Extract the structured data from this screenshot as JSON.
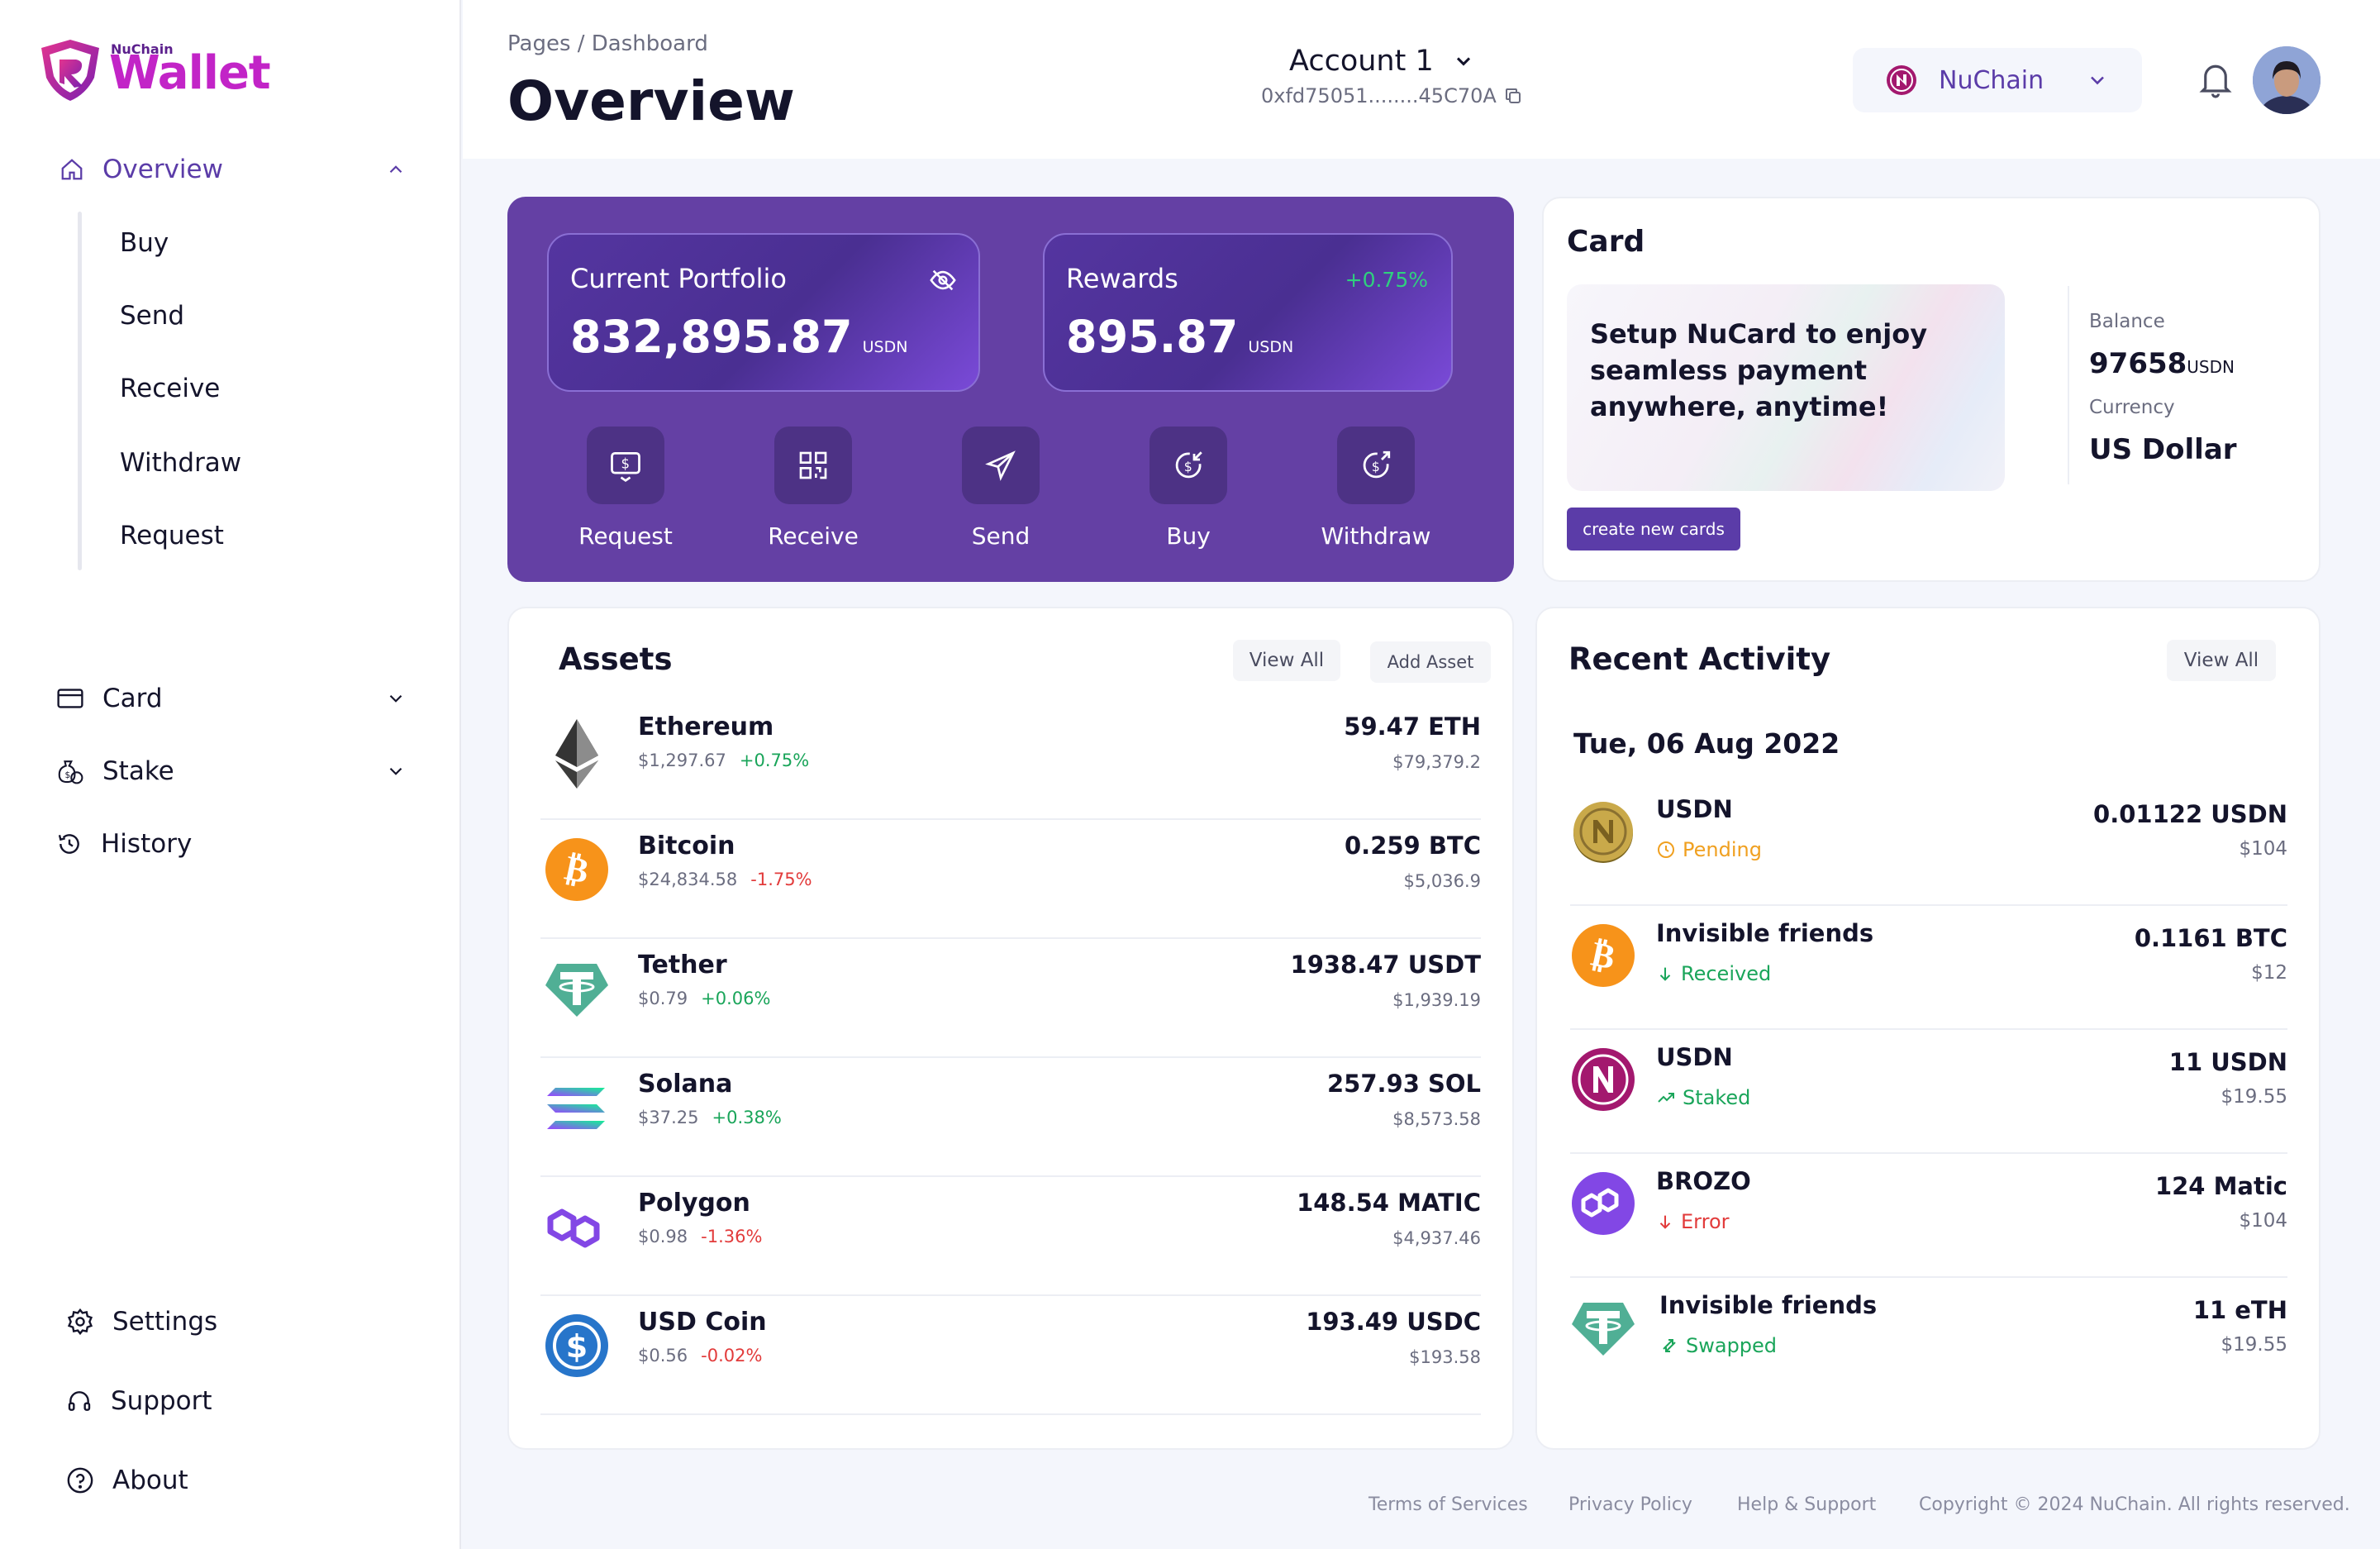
{
  "brand": {
    "small": "NuChain",
    "big": "Wallet"
  },
  "sidebar": {
    "overview": "Overview",
    "sub_items": [
      "Buy",
      "Send",
      "Receive",
      "Withdraw",
      "Request"
    ],
    "card": "Card",
    "stake": "Stake",
    "history": "History",
    "settings": "Settings",
    "support": "Support",
    "about": "About"
  },
  "header": {
    "breadcrumb": "Pages / Dashboard",
    "title": "Overview",
    "account": "Account 1",
    "address": "0xfd75051........45C70A",
    "chain": "NuChain"
  },
  "hero": {
    "portfolio": {
      "title": "Current Portfolio",
      "value": "832,895.87",
      "unit": "USDN"
    },
    "rewards": {
      "title": "Rewards",
      "value": "895.87",
      "unit": "USDN",
      "change": "+0.75%"
    },
    "actions": [
      "Request",
      "Receive",
      "Send",
      "Buy",
      "Withdraw"
    ]
  },
  "card_panel": {
    "title": "Card",
    "promo": "Setup NuCard to enjoy seamless payment anywhere, anytime!",
    "button": "create new cards",
    "balance_label": "Balance",
    "balance": "97658",
    "balance_unit": "USDN",
    "currency_label": "Currency",
    "currency": "US Dollar"
  },
  "assets": {
    "title": "Assets",
    "view_all": "View All",
    "add_asset": "Add Asset",
    "rows": [
      {
        "name": "Ethereum",
        "price": "$1,297.67",
        "change": "+0.75%",
        "amount": "59.47 ETH",
        "usd": "$79,379.2"
      },
      {
        "name": "Bitcoin",
        "price": "$24,834.58",
        "change": "-1.75%",
        "amount": "0.259 BTC",
        "usd": "$5,036.9"
      },
      {
        "name": "Tether",
        "price": "$0.79",
        "change": "+0.06%",
        "amount": "1938.47 USDT",
        "usd": "$1,939.19"
      },
      {
        "name": "Solana",
        "price": "$37.25",
        "change": "+0.38%",
        "amount": "257.93 SOL",
        "usd": "$8,573.58"
      },
      {
        "name": "Polygon",
        "price": "$0.98",
        "change": "-1.36%",
        "amount": "148.54 MATIC",
        "usd": "$4,937.46"
      },
      {
        "name": "USD Coin",
        "price": "$0.56",
        "change": "-0.02%",
        "amount": "193.49 USDC",
        "usd": "$193.58"
      }
    ]
  },
  "recent": {
    "title": "Recent Activity",
    "view_all": "View All",
    "date": "Tue, 06 Aug 2022",
    "rows": [
      {
        "name": "USDN",
        "status": "Pending",
        "amount": "0.01122 USDN",
        "usd": "$104"
      },
      {
        "name": "Invisible friends",
        "status": "Received",
        "amount": "0.1161 BTC",
        "usd": "$12"
      },
      {
        "name": "USDN",
        "status": "Staked",
        "amount": "11 USDN",
        "usd": "$19.55"
      },
      {
        "name": "BROZO",
        "status": "Error",
        "amount": "124 Matic",
        "usd": "$104"
      },
      {
        "name": "Invisible friends",
        "status": "Swapped",
        "amount": "11 eTH",
        "usd": "$19.55"
      }
    ]
  },
  "footer": {
    "terms": "Terms of Services",
    "privacy": "Privacy Policy",
    "help": "Help & Support",
    "copyright": "Copyright © 2024 NuChain. All rights reserved."
  },
  "colors": {
    "accent": "#5b3ca8",
    "hero_bg": "#6440a4",
    "positive": "#1aa55a",
    "negative": "#e23b3b",
    "pending": "#f0a020"
  }
}
